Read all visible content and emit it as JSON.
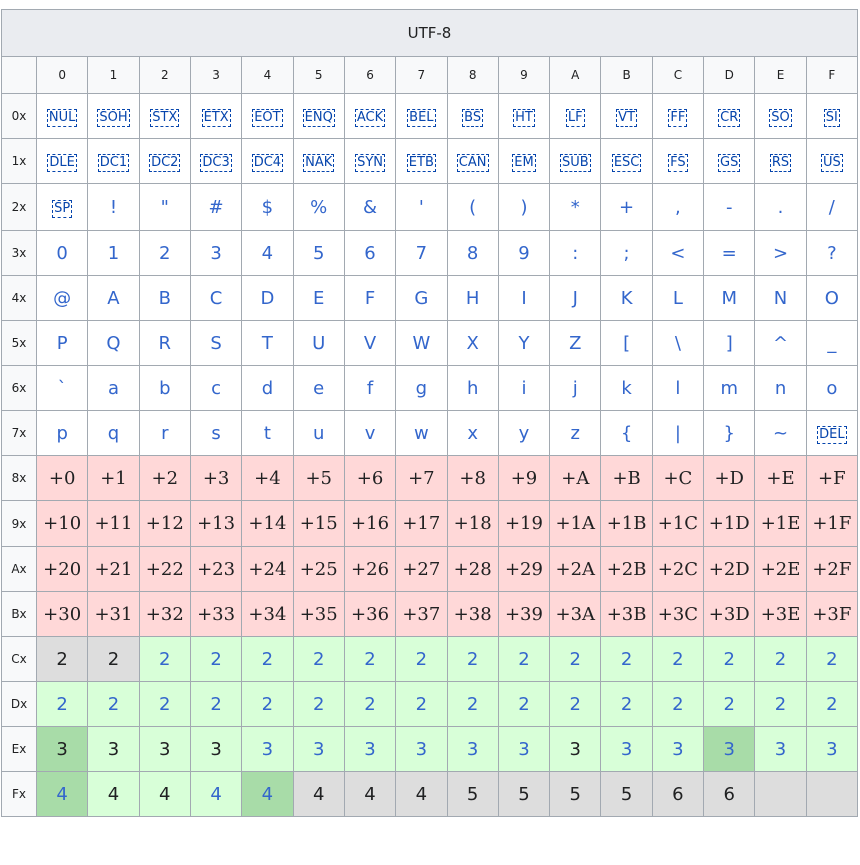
{
  "title": "UTF-8",
  "column_headers": [
    "0",
    "1",
    "2",
    "3",
    "4",
    "5",
    "6",
    "7",
    "8",
    "9",
    "A",
    "B",
    "C",
    "D",
    "E",
    "F"
  ],
  "rows": [
    {
      "label": "0x",
      "cells": [
        "NUL",
        "SOH",
        "STX",
        "ETX",
        "EOT",
        "ENQ",
        "ACK",
        "BEL",
        "BS",
        "HT",
        "LF",
        "VT",
        "FF",
        "CR",
        "SO",
        "SI"
      ]
    },
    {
      "label": "1x",
      "cells": [
        "DLE",
        "DC1",
        "DC2",
        "DC3",
        "DC4",
        "NAK",
        "SYN",
        "ETB",
        "CAN",
        "EM",
        "SUB",
        "ESC",
        "FS",
        "GS",
        "RS",
        "US"
      ]
    },
    {
      "label": "2x",
      "cells": [
        "SP",
        "!",
        "\"",
        "#",
        "$",
        "%",
        "&",
        "'",
        "(",
        ")",
        "*",
        "+",
        ",",
        "-",
        ".",
        "/"
      ]
    },
    {
      "label": "3x",
      "cells": [
        "0",
        "1",
        "2",
        "3",
        "4",
        "5",
        "6",
        "7",
        "8",
        "9",
        ":",
        ";",
        "<",
        "=",
        ">",
        "?"
      ]
    },
    {
      "label": "4x",
      "cells": [
        "@",
        "A",
        "B",
        "C",
        "D",
        "E",
        "F",
        "G",
        "H",
        "I",
        "J",
        "K",
        "L",
        "M",
        "N",
        "O"
      ]
    },
    {
      "label": "5x",
      "cells": [
        "P",
        "Q",
        "R",
        "S",
        "T",
        "U",
        "V",
        "W",
        "X",
        "Y",
        "Z",
        "[",
        "\\",
        "]",
        "^",
        "_"
      ]
    },
    {
      "label": "6x",
      "cells": [
        "`",
        "a",
        "b",
        "c",
        "d",
        "e",
        "f",
        "g",
        "h",
        "i",
        "j",
        "k",
        "l",
        "m",
        "n",
        "o"
      ]
    },
    {
      "label": "7x",
      "cells": [
        "p",
        "q",
        "r",
        "s",
        "t",
        "u",
        "v",
        "w",
        "x",
        "y",
        "z",
        "{",
        "|",
        "}",
        "~",
        "DEL"
      ]
    },
    {
      "label": "8x",
      "cells": [
        "+0",
        "+1",
        "+2",
        "+3",
        "+4",
        "+5",
        "+6",
        "+7",
        "+8",
        "+9",
        "+A",
        "+B",
        "+C",
        "+D",
        "+E",
        "+F"
      ]
    },
    {
      "label": "9x",
      "cells": [
        "+10",
        "+11",
        "+12",
        "+13",
        "+14",
        "+15",
        "+16",
        "+17",
        "+18",
        "+19",
        "+1A",
        "+1B",
        "+1C",
        "+1D",
        "+1E",
        "+1F"
      ]
    },
    {
      "label": "Ax",
      "cells": [
        "+20",
        "+21",
        "+22",
        "+23",
        "+24",
        "+25",
        "+26",
        "+27",
        "+28",
        "+29",
        "+2A",
        "+2B",
        "+2C",
        "+2D",
        "+2E",
        "+2F"
      ]
    },
    {
      "label": "Bx",
      "cells": [
        "+30",
        "+31",
        "+32",
        "+33",
        "+34",
        "+35",
        "+36",
        "+37",
        "+38",
        "+39",
        "+3A",
        "+3B",
        "+3C",
        "+3D",
        "+3E",
        "+3F"
      ]
    },
    {
      "label": "Cx",
      "cells": [
        "2",
        "2",
        "2",
        "2",
        "2",
        "2",
        "2",
        "2",
        "2",
        "2",
        "2",
        "2",
        "2",
        "2",
        "2",
        "2"
      ]
    },
    {
      "label": "Dx",
      "cells": [
        "2",
        "2",
        "2",
        "2",
        "2",
        "2",
        "2",
        "2",
        "2",
        "2",
        "2",
        "2",
        "2",
        "2",
        "2",
        "2"
      ]
    },
    {
      "label": "Ex",
      "cells": [
        "3",
        "3",
        "3",
        "3",
        "3",
        "3",
        "3",
        "3",
        "3",
        "3",
        "3",
        "3",
        "3",
        "3",
        "3",
        "3"
      ]
    },
    {
      "label": "Fx",
      "cells": [
        "4",
        "4",
        "4",
        "4",
        "4",
        "4",
        "4",
        "4",
        "5",
        "5",
        "5",
        "5",
        "6",
        "6",
        "",
        ""
      ]
    }
  ],
  "cell_styles": [
    [
      "ctrl",
      "ctrl",
      "ctrl",
      "ctrl",
      "ctrl",
      "ctrl",
      "ctrl",
      "ctrl",
      "ctrl",
      "ctrl",
      "ctrl",
      "ctrl",
      "ctrl",
      "ctrl",
      "ctrl",
      "ctrl"
    ],
    [
      "ctrl",
      "ctrl",
      "ctrl",
      "ctrl",
      "ctrl",
      "ctrl",
      "ctrl",
      "ctrl",
      "ctrl",
      "ctrl",
      "ctrl",
      "ctrl",
      "ctrl",
      "ctrl",
      "ctrl",
      "ctrl"
    ],
    [
      "ctrl",
      "ascii",
      "ascii",
      "ascii",
      "ascii",
      "ascii",
      "ascii",
      "ascii",
      "ascii",
      "ascii",
      "ascii",
      "ascii",
      "ascii",
      "ascii",
      "ascii",
      "ascii"
    ],
    [
      "ascii",
      "ascii",
      "ascii",
      "ascii",
      "ascii",
      "ascii",
      "ascii",
      "ascii",
      "ascii",
      "ascii",
      "ascii",
      "ascii",
      "ascii",
      "ascii",
      "ascii",
      "ascii"
    ],
    [
      "ascii",
      "ascii",
      "ascii",
      "ascii",
      "ascii",
      "ascii",
      "ascii",
      "ascii",
      "ascii",
      "ascii",
      "ascii",
      "ascii",
      "ascii",
      "ascii",
      "ascii",
      "ascii"
    ],
    [
      "ascii",
      "ascii",
      "ascii",
      "ascii",
      "ascii",
      "ascii",
      "ascii",
      "ascii",
      "ascii",
      "ascii",
      "ascii",
      "ascii",
      "ascii",
      "ascii",
      "ascii",
      "ascii"
    ],
    [
      "ascii",
      "ascii",
      "ascii",
      "ascii",
      "ascii",
      "ascii",
      "ascii",
      "ascii",
      "ascii",
      "ascii",
      "ascii",
      "ascii",
      "ascii",
      "ascii",
      "ascii",
      "ascii"
    ],
    [
      "ascii",
      "ascii",
      "ascii",
      "ascii",
      "ascii",
      "ascii",
      "ascii",
      "ascii",
      "ascii",
      "ascii",
      "ascii",
      "ascii",
      "ascii",
      "ascii",
      "ascii",
      "ctrl"
    ],
    [
      "cont",
      "cont",
      "cont",
      "cont",
      "cont",
      "cont",
      "cont",
      "cont",
      "cont",
      "cont",
      "cont",
      "cont",
      "cont",
      "cont",
      "cont",
      "cont"
    ],
    [
      "cont",
      "cont",
      "cont",
      "cont",
      "cont",
      "cont",
      "cont",
      "cont",
      "cont",
      "cont",
      "cont",
      "cont",
      "cont",
      "cont",
      "cont",
      "cont"
    ],
    [
      "cont",
      "cont",
      "cont",
      "cont",
      "cont",
      "cont",
      "cont",
      "cont",
      "cont",
      "cont",
      "cont",
      "cont",
      "cont",
      "cont",
      "cont",
      "cont"
    ],
    [
      "cont",
      "cont",
      "cont",
      "cont",
      "cont",
      "cont",
      "cont",
      "cont",
      "cont",
      "cont",
      "cont",
      "cont",
      "cont",
      "cont",
      "cont",
      "cont"
    ],
    [
      "over",
      "over",
      "lead",
      "lead",
      "lead",
      "lead",
      "lead",
      "lead",
      "lead",
      "lead",
      "lead",
      "lead",
      "lead",
      "lead",
      "lead",
      "lead"
    ],
    [
      "lead",
      "lead",
      "lead",
      "lead",
      "lead",
      "lead",
      "lead",
      "lead",
      "lead",
      "lead",
      "lead",
      "lead",
      "lead",
      "lead",
      "lead",
      "lead"
    ],
    [
      "darkb",
      "ovd",
      "ovd",
      "ovd",
      "lead",
      "lead",
      "lead",
      "lead",
      "lead",
      "lead",
      "ovd",
      "lead",
      "lead",
      "dark",
      "lead",
      "lead"
    ],
    [
      "dark",
      "ovd",
      "ovd",
      "lead",
      "dark",
      "over",
      "over",
      "over",
      "over",
      "over",
      "over",
      "over",
      "over",
      "over",
      "empty",
      "empty"
    ]
  ],
  "colors": {
    "header_bg": "#eaecf0",
    "continuation_bg": "#ffd8d8",
    "lead_bg": "#d8ffd8",
    "lead_highlight_bg": "#a8dca8",
    "invalid_bg": "#dddddd",
    "link_blue": "#3366cc",
    "border": "#a2a9b1"
  }
}
